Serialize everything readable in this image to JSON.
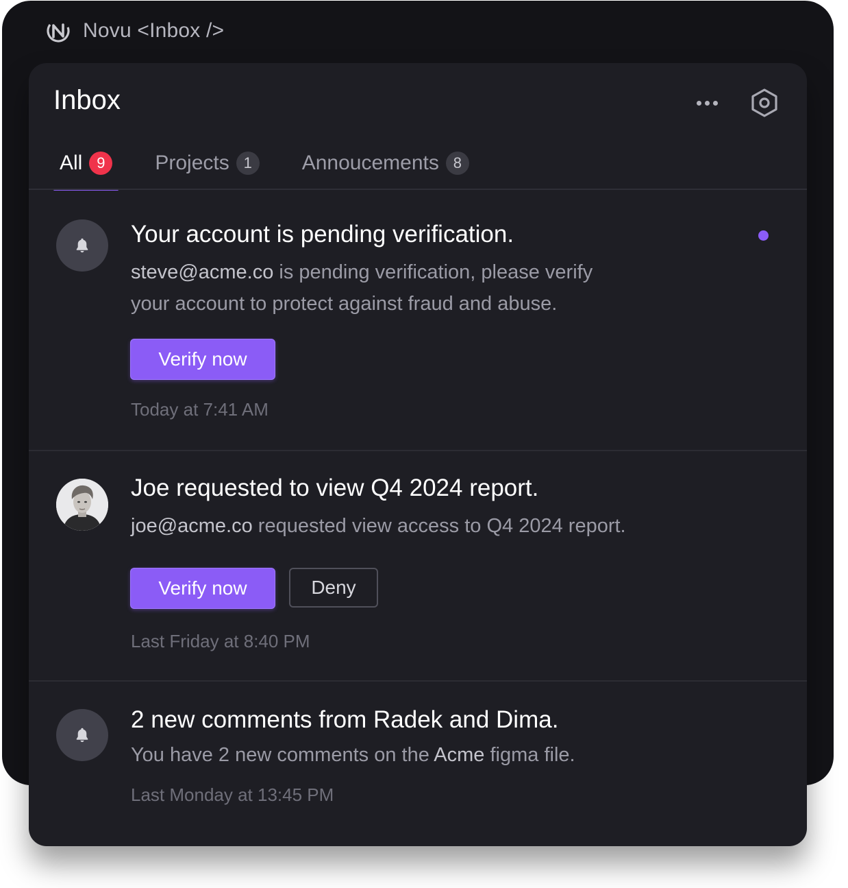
{
  "app": {
    "brand_name": "Novu <Inbox />"
  },
  "inbox": {
    "title": "Inbox",
    "tabs": [
      {
        "label": "All",
        "count": "9",
        "active": true
      },
      {
        "label": "Projects",
        "count": "1",
        "active": false
      },
      {
        "label": "Annoucements",
        "count": "8",
        "active": false
      }
    ]
  },
  "notifications": [
    {
      "title": "Your account is pending verification.",
      "body_highlight": "steve@acme.co",
      "body_line1_rest": " is pending verification, please verify",
      "body_line2": "your account to protect against fraud and abuse.",
      "primary_action": "Verify now",
      "time": "Today at 7:41 AM",
      "unread": true,
      "avatar": "bell-icon"
    },
    {
      "title": "Joe requested to view Q4 2024 report.",
      "body_highlight": "joe@acme.co",
      "body_rest": " requested view access to Q4 2024 report.",
      "primary_action": "Verify now",
      "secondary_action": "Deny",
      "time": "Last Friday at 8:40 PM",
      "unread": false,
      "avatar": "user-photo"
    },
    {
      "title": "2 new comments from Radek and Dima.",
      "body_prefix": "You have 2 new comments on the ",
      "body_highlight": "Acme",
      "body_suffix": " figma file.",
      "time": "Last Monday at 13:45 PM",
      "unread": false,
      "avatar": "bell-icon"
    }
  ],
  "colors": {
    "accent": "#8b5cf6",
    "badge_active": "#f0334b",
    "panel_bg": "#1e1e24",
    "outer_bg": "#131317"
  }
}
